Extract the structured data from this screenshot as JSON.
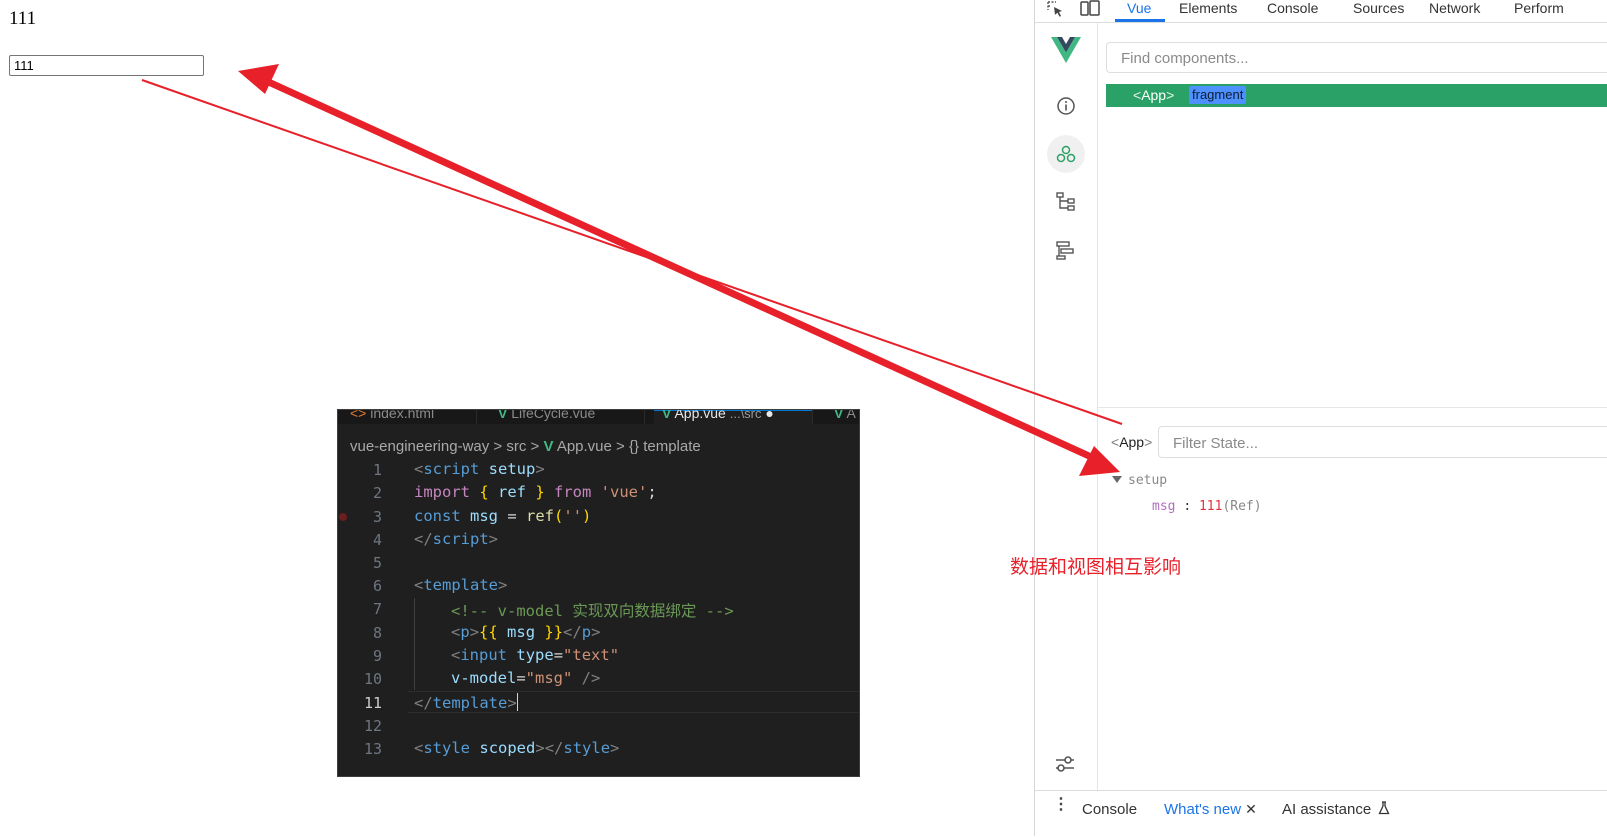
{
  "page": {
    "paragraph_text": "111",
    "input_value": "111"
  },
  "devtools": {
    "tabs": [
      "Vue",
      "Elements",
      "Console",
      "Sources",
      "Network",
      "Perform"
    ],
    "active_tab": "Vue",
    "icons": {
      "inspect": "inspect-element-icon",
      "device": "device-toolbar-icon"
    },
    "vue_panel": {
      "logo": "vue-logo-icon",
      "rail": [
        "info-icon",
        "components-icon",
        "component-tree-icon",
        "timeline-icon"
      ],
      "settings": "settings-sliders-icon",
      "find_placeholder": "Find components...",
      "tree": {
        "open": "<",
        "name": "App",
        "close": ">",
        "badge": "fragment"
      },
      "state": {
        "component_open": "<",
        "component_name": "App",
        "component_close": ">",
        "filter_placeholder": "Filter State...",
        "section": "setup",
        "key": "msg",
        "colon": ":",
        "value": "111",
        "type": "(Ref)"
      }
    },
    "drawer": {
      "menu": "⋮",
      "tabs": [
        "Console",
        "What's new",
        "AI assistance"
      ],
      "close": "✕",
      "flask": "flask-icon"
    }
  },
  "annotation": {
    "text": "数据和视图相互影响",
    "arrow_color": "#e8202a"
  },
  "editor": {
    "tabs": [
      "index.html",
      "LifeCycle.vue",
      "App.vue",
      "...\\src",
      "A"
    ],
    "breadcrumb": [
      "vue-engineering-way",
      ">",
      "src",
      ">",
      "App.vue",
      ">",
      "{}",
      "template"
    ],
    "current_line": 11,
    "line_numbers": [
      "1",
      "2",
      "3",
      "4",
      "5",
      "6",
      "7",
      "8",
      "9",
      "10",
      "11",
      "12",
      "13"
    ],
    "code": {
      "l1": [
        "<",
        "script",
        " setup",
        ">"
      ],
      "l2": [
        "import",
        " { ",
        "ref",
        " } ",
        "from",
        " ",
        "'vue'",
        ";"
      ],
      "l3": [
        "const",
        " ",
        "msg",
        " = ",
        "ref",
        "(",
        "''",
        ")"
      ],
      "l4": [
        "</",
        "script",
        ">"
      ],
      "l6": [
        "<",
        "template",
        ">"
      ],
      "l7": [
        "<!-- v-model ",
        "实现双向数据绑定",
        " -->"
      ],
      "l8": [
        "<",
        "p",
        ">",
        "{{",
        " msg ",
        "}}",
        "</",
        "p",
        ">"
      ],
      "l9": [
        "<",
        "input",
        " ",
        "type",
        "=",
        "\"text\""
      ],
      "l10": [
        "v-model",
        "=",
        "\"msg\"",
        " />"
      ],
      "l11": [
        "</",
        "template",
        ">"
      ],
      "l13": [
        "<",
        "style",
        " ",
        "scoped",
        ">",
        "</",
        "style",
        ">"
      ]
    }
  }
}
